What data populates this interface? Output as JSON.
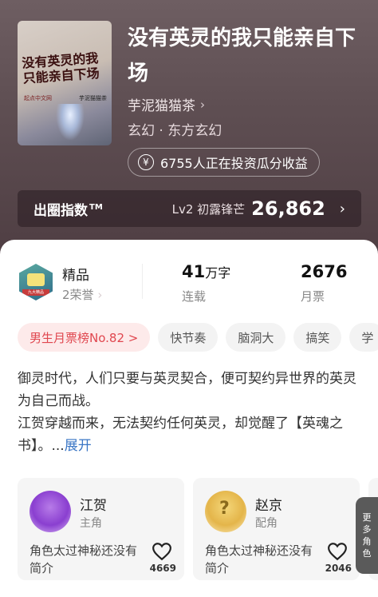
{
  "book": {
    "title": "没有英灵的我只能亲自下场",
    "author": "芋泥猫猫茶",
    "genre": "玄幻 · 东方玄幻",
    "invest_text": "6755人正在投资瓜分收益",
    "cover": {
      "title": "没有英灵的我只能亲自下场",
      "publisher": "起点中文网",
      "author": "芋泥猫猫茶"
    }
  },
  "heat": {
    "label": "出圈指数",
    "tm": "TM",
    "level": "Lv2 初露锋芒",
    "score": "26,862"
  },
  "stats": {
    "quality": "精品",
    "honors": "2荣誉",
    "badge_text": "九大精品",
    "words_value": "41",
    "words_unit": "万字",
    "status": "连载",
    "monthly_tickets": "2676",
    "monthly_label": "月票"
  },
  "tags": [
    "男生月票榜No.82 >",
    "快节奏",
    "脑洞大",
    "搞笑",
    "学"
  ],
  "description": {
    "text": "御灵时代，人们只要与英灵契合，便可契约异世界的英灵为自己而战。\n江贺穿越而来，无法契约任何英灵，却觉醒了【英魂之书】。...",
    "expand": "展开"
  },
  "characters": [
    {
      "name": "江贺",
      "role": "主角",
      "intro": "角色太过神秘还没有简介",
      "likes": "4669"
    },
    {
      "name": "赵京",
      "role": "配角",
      "intro": "角色太过神秘还没有简介",
      "likes": "2046"
    }
  ],
  "more_characters": "更多角色"
}
